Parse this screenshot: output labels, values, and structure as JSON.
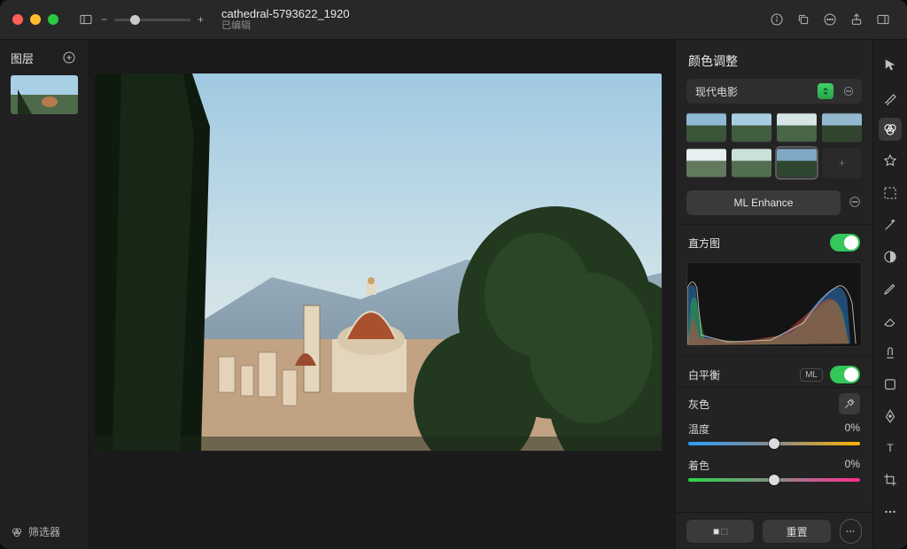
{
  "titlebar": {
    "filename": "cathedral-5793622_1920",
    "status": "已编辑",
    "icons": {
      "sidebar": "sidebar-icon",
      "zoom_minus": "−",
      "zoom_plus": "+",
      "info": "info-icon",
      "duplicate": "duplicate-icon",
      "more": "more-icon",
      "share": "share-icon",
      "panel": "panel-icon"
    }
  },
  "left_panel": {
    "title": "图层",
    "add_label": "+",
    "filter_label": "筛选器"
  },
  "right_panel": {
    "title": "颜色调整",
    "preset": {
      "label": "现代电影"
    },
    "ml_enhance": "ML Enhance",
    "histogram": {
      "label": "直方图",
      "on": true
    },
    "white_balance": {
      "label": "白平衡",
      "ml_chip": "ML",
      "on": true
    },
    "grey": {
      "label": "灰色"
    },
    "temperature": {
      "label": "温度",
      "value": "0%"
    },
    "tint": {
      "label": "着色",
      "value": "0%"
    },
    "footer": {
      "reset": "重置",
      "split_before": "■",
      "split_after": "□"
    }
  },
  "tools": [
    "pointer",
    "brush",
    "color-adjust",
    "star",
    "marquee",
    "magic-wand",
    "color-picker",
    "pencil",
    "eraser",
    "shape",
    "pen",
    "text",
    "crop",
    "more"
  ]
}
